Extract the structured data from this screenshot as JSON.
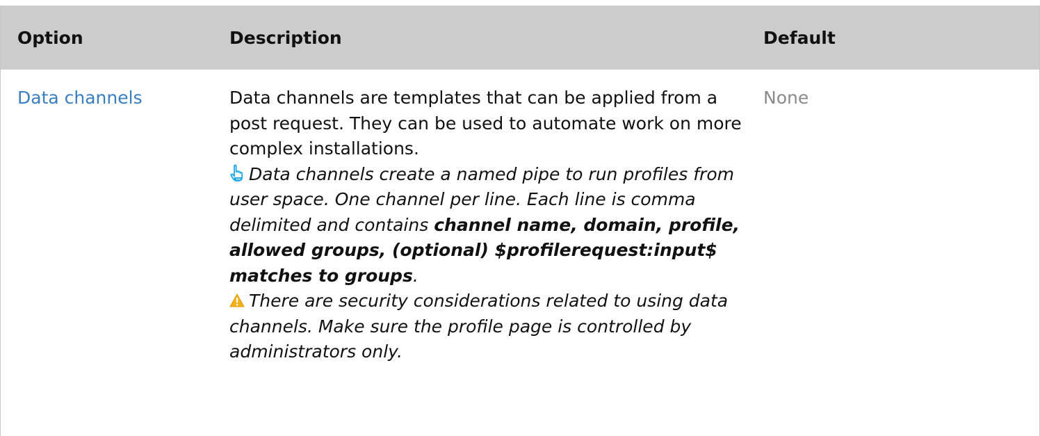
{
  "table": {
    "headers": {
      "option": "Option",
      "description": "Description",
      "default": "Default"
    },
    "rows": [
      {
        "option": "Data channels",
        "description": {
          "intro": "Data channels are templates that can be applied from a post request. They can be used to automate work on more complex installations.",
          "hint_icon": "pointing-hand-icon",
          "hint_text": "Data channels create a named pipe to run profiles from user space. One channel per line. Each line is comma delimited and contains",
          "hint_bold": "channel name, domain, profile, allowed groups, (optional) $profilerequest:input$ matches to groups",
          "hint_end": ".",
          "warning_icon": "warning-icon",
          "warning_text": "There are security considerations related to using data channels. Make sure the profile page is controlled by administrators only."
        },
        "default": "None"
      }
    ]
  },
  "colors": {
    "header_bg": "#cccccc",
    "link": "#3a7ec2",
    "muted": "#8a8a8a",
    "hint_icon": "#1ea7e8",
    "warning_icon": "#f2b21a"
  }
}
